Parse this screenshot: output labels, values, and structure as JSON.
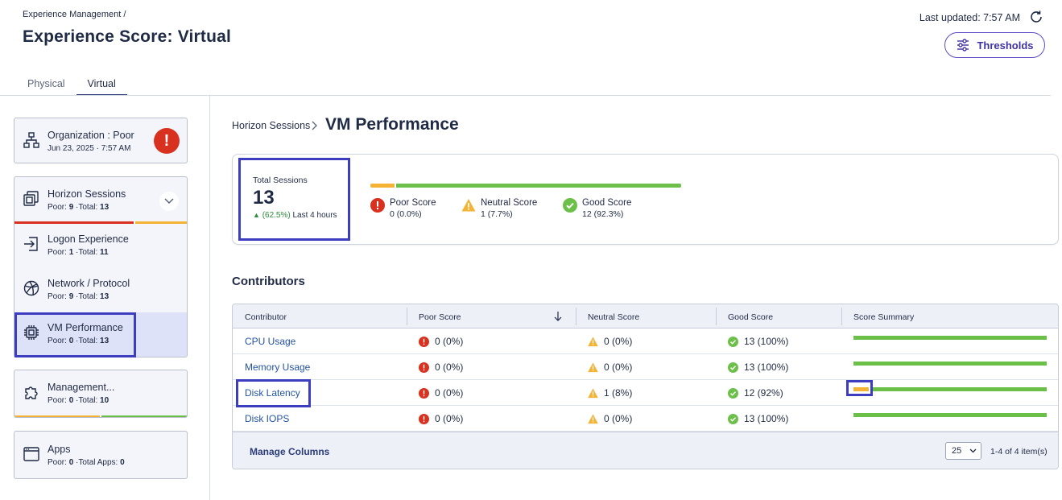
{
  "header": {
    "breadcrumb": "Experience Management  /",
    "title": "Experience Score: Virtual",
    "last_updated": "Last updated: 7:57 AM",
    "thresholds_label": "Thresholds"
  },
  "tabs": [
    {
      "label": "Physical",
      "active": false
    },
    {
      "label": "Virtual",
      "active": true
    }
  ],
  "sidebar": {
    "organization": {
      "title": "Organization : Poor",
      "sub": "Jun 23, 2025 · 7:57 AM",
      "alert": "!"
    },
    "horizon": {
      "title": "Horizon Sessions",
      "poor_label": "Poor:",
      "poor": "9",
      "total_label": "·Total:",
      "total": "13"
    },
    "logon": {
      "title": "Logon Experience",
      "poor_label": "Poor:",
      "poor": "1",
      "total_label": "·Total:",
      "total": "11"
    },
    "network": {
      "title": "Network / Protocol",
      "poor_label": "Poor:",
      "poor": "9",
      "total_label": "·Total:",
      "total": "13"
    },
    "vm": {
      "title": "VM Performance",
      "poor_label": "Poor:",
      "poor": "0",
      "total_label": "·Total:",
      "total": "13"
    },
    "management": {
      "title": "Management...",
      "poor_label": "Poor:",
      "poor": "0",
      "total_label": "·Total:",
      "total": "10"
    },
    "apps": {
      "title": "Apps",
      "poor_label": "Poor:",
      "poor": "0",
      "total_label": "·Total Apps:",
      "total": "0"
    }
  },
  "main": {
    "crumb_parent": "Horizon Sessions",
    "crumb_current": "VM Performance",
    "total_sessions_label": "Total Sessions",
    "total_sessions_value": "13",
    "delta_pct": "(62.5%)",
    "delta_period": "Last 4 hours",
    "distribution": {
      "poor": 0,
      "neutral": 1,
      "good": 12
    },
    "legend": [
      {
        "title": "Poor Score",
        "value": "0 (0.0%)",
        "icon": "error-circle-icon",
        "color": "#d8311f"
      },
      {
        "title": "Neutral Score",
        "value": "1 (7.7%)",
        "icon": "warning-triangle-icon",
        "color": "#f5b335"
      },
      {
        "title": "Good Score",
        "value": "12 (92.3%)",
        "icon": "check-circle-icon",
        "color": "#6cc04a"
      }
    ],
    "contributors_title": "Contributors"
  },
  "table": {
    "headers": [
      "Contributor",
      "Poor Score",
      "Neutral Score",
      "Good Score",
      "Score Summary"
    ],
    "rows": [
      {
        "name": "CPU Usage",
        "poor": "0 (0%)",
        "neutral": "0 (0%)",
        "good": "13 (100%)",
        "neutral_frac": 0,
        "good_frac": 1
      },
      {
        "name": "Memory Usage",
        "poor": "0 (0%)",
        "neutral": "0 (0%)",
        "good": "13 (100%)",
        "neutral_frac": 0,
        "good_frac": 1
      },
      {
        "name": "Disk Latency",
        "poor": "0 (0%)",
        "neutral": "1 (8%)",
        "good": "12 (92%)",
        "neutral_frac": 0.08,
        "good_frac": 0.92
      },
      {
        "name": "Disk IOPS",
        "poor": "0 (0%)",
        "neutral": "0 (0%)",
        "good": "13 (100%)",
        "neutral_frac": 0,
        "good_frac": 1
      }
    ],
    "manage_columns": "Manage Columns",
    "page_size": "25",
    "page_info": "1-4 of 4 item(s)"
  },
  "colors": {
    "accent": "#3d3dbf",
    "poor": "#d8311f",
    "neutral": "#f5b335",
    "good": "#6cc04a",
    "link": "#2452a6"
  }
}
